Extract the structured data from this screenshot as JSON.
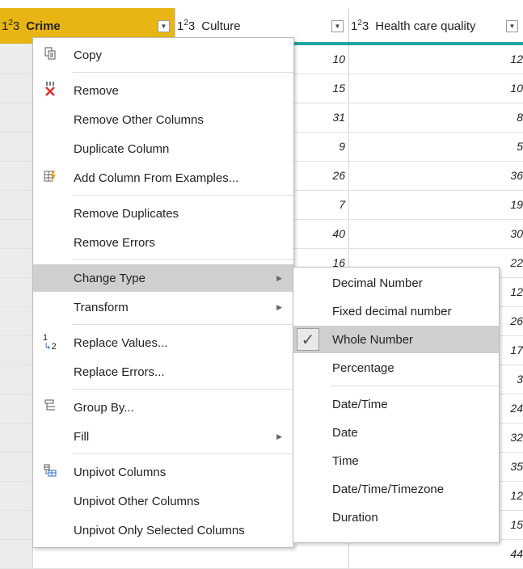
{
  "header": {
    "type_icon": "1²3",
    "columns": [
      {
        "label": "Crime"
      },
      {
        "label": "Culture"
      },
      {
        "label": "Health care quality"
      }
    ]
  },
  "rows": [
    {
      "culture": "10",
      "health": "12"
    },
    {
      "culture": "15",
      "health": "10"
    },
    {
      "culture": "31",
      "health": "8"
    },
    {
      "culture": "9",
      "health": "5"
    },
    {
      "culture": "26",
      "health": "36"
    },
    {
      "culture": "7",
      "health": "19"
    },
    {
      "culture": "40",
      "health": "30"
    },
    {
      "culture": "16",
      "health": "22"
    },
    {
      "culture": "",
      "health": "12"
    },
    {
      "culture": "",
      "health": "26"
    },
    {
      "culture": "",
      "health": "17"
    },
    {
      "culture": "",
      "health": "3"
    },
    {
      "culture": "",
      "health": "24"
    },
    {
      "culture": "",
      "health": "32"
    },
    {
      "culture": "",
      "health": "35"
    },
    {
      "culture": "",
      "health": "12"
    },
    {
      "culture": "",
      "health": "15"
    },
    {
      "culture": "",
      "health": "44"
    }
  ],
  "context_menu": {
    "items": [
      {
        "label": "Copy",
        "icon": "copy-icon"
      },
      {
        "label": "Remove",
        "icon": "remove-icon"
      },
      {
        "label": "Remove Other Columns"
      },
      {
        "label": "Duplicate Column"
      },
      {
        "label": "Add Column From Examples...",
        "icon": "add-column-examples-icon"
      },
      {
        "label": "Remove Duplicates"
      },
      {
        "label": "Remove Errors"
      },
      {
        "label": "Change Type",
        "submenu": true,
        "highlighted": true
      },
      {
        "label": "Transform",
        "submenu": true
      },
      {
        "label": "Replace Values...",
        "icon": "replace-values-icon"
      },
      {
        "label": "Replace Errors..."
      },
      {
        "label": "Group By...",
        "icon": "group-by-icon"
      },
      {
        "label": "Fill",
        "submenu": true
      },
      {
        "label": "Unpivot Columns",
        "icon": "unpivot-icon"
      },
      {
        "label": "Unpivot Other Columns"
      },
      {
        "label": "Unpivot Only Selected Columns"
      }
    ]
  },
  "change_type_submenu": {
    "items": [
      {
        "label": "Decimal Number"
      },
      {
        "label": "Fixed decimal number"
      },
      {
        "label": "Whole Number",
        "checked": true
      },
      {
        "label": "Percentage"
      },
      {
        "label": "Date/Time"
      },
      {
        "label": "Date"
      },
      {
        "label": "Time"
      },
      {
        "label": "Date/Time/Timezone"
      },
      {
        "label": "Duration"
      }
    ]
  }
}
